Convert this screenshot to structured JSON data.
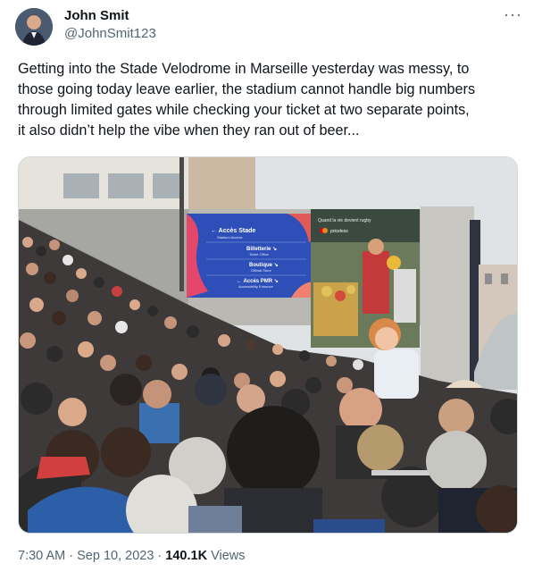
{
  "tweet": {
    "author_name": "John Smit",
    "author_handle": "@JohnSmit123",
    "more_icon": "more-horizontal-icon",
    "text_lines": [
      "Getting into the Stade Velodrome in Marseille yesterday was messy, to",
      "those going today leave earlier, the stadium cannot handle big numbers",
      "through limited gates while checking your ticket at two separate points,",
      "it also didn’t help the vibe when they ran out of beer..."
    ],
    "time": "7:30 AM",
    "date": "Sep 10, 2023",
    "separator": "·",
    "views_count": "140.1K",
    "views_label": "Views"
  },
  "photo": {
    "sign_title": "← Accès Stade",
    "sign_sub": "Stadium Access",
    "sign_items": [
      {
        "label": "Billetterie ↘",
        "sub": "Ticket Office"
      },
      {
        "label": "Boutique ↘",
        "sub": "Official Store"
      },
      {
        "label": "← Accès PMR ↘",
        "sub": "Accessibility Entrance"
      }
    ],
    "billboard_line1": "Quand la vie devient rugby",
    "billboard_line2": "priceless"
  },
  "colors": {
    "text": "#0f1419",
    "secondary": "#536471",
    "sign_blue": "#2e4fb8",
    "sky": "#dfe3e6"
  }
}
